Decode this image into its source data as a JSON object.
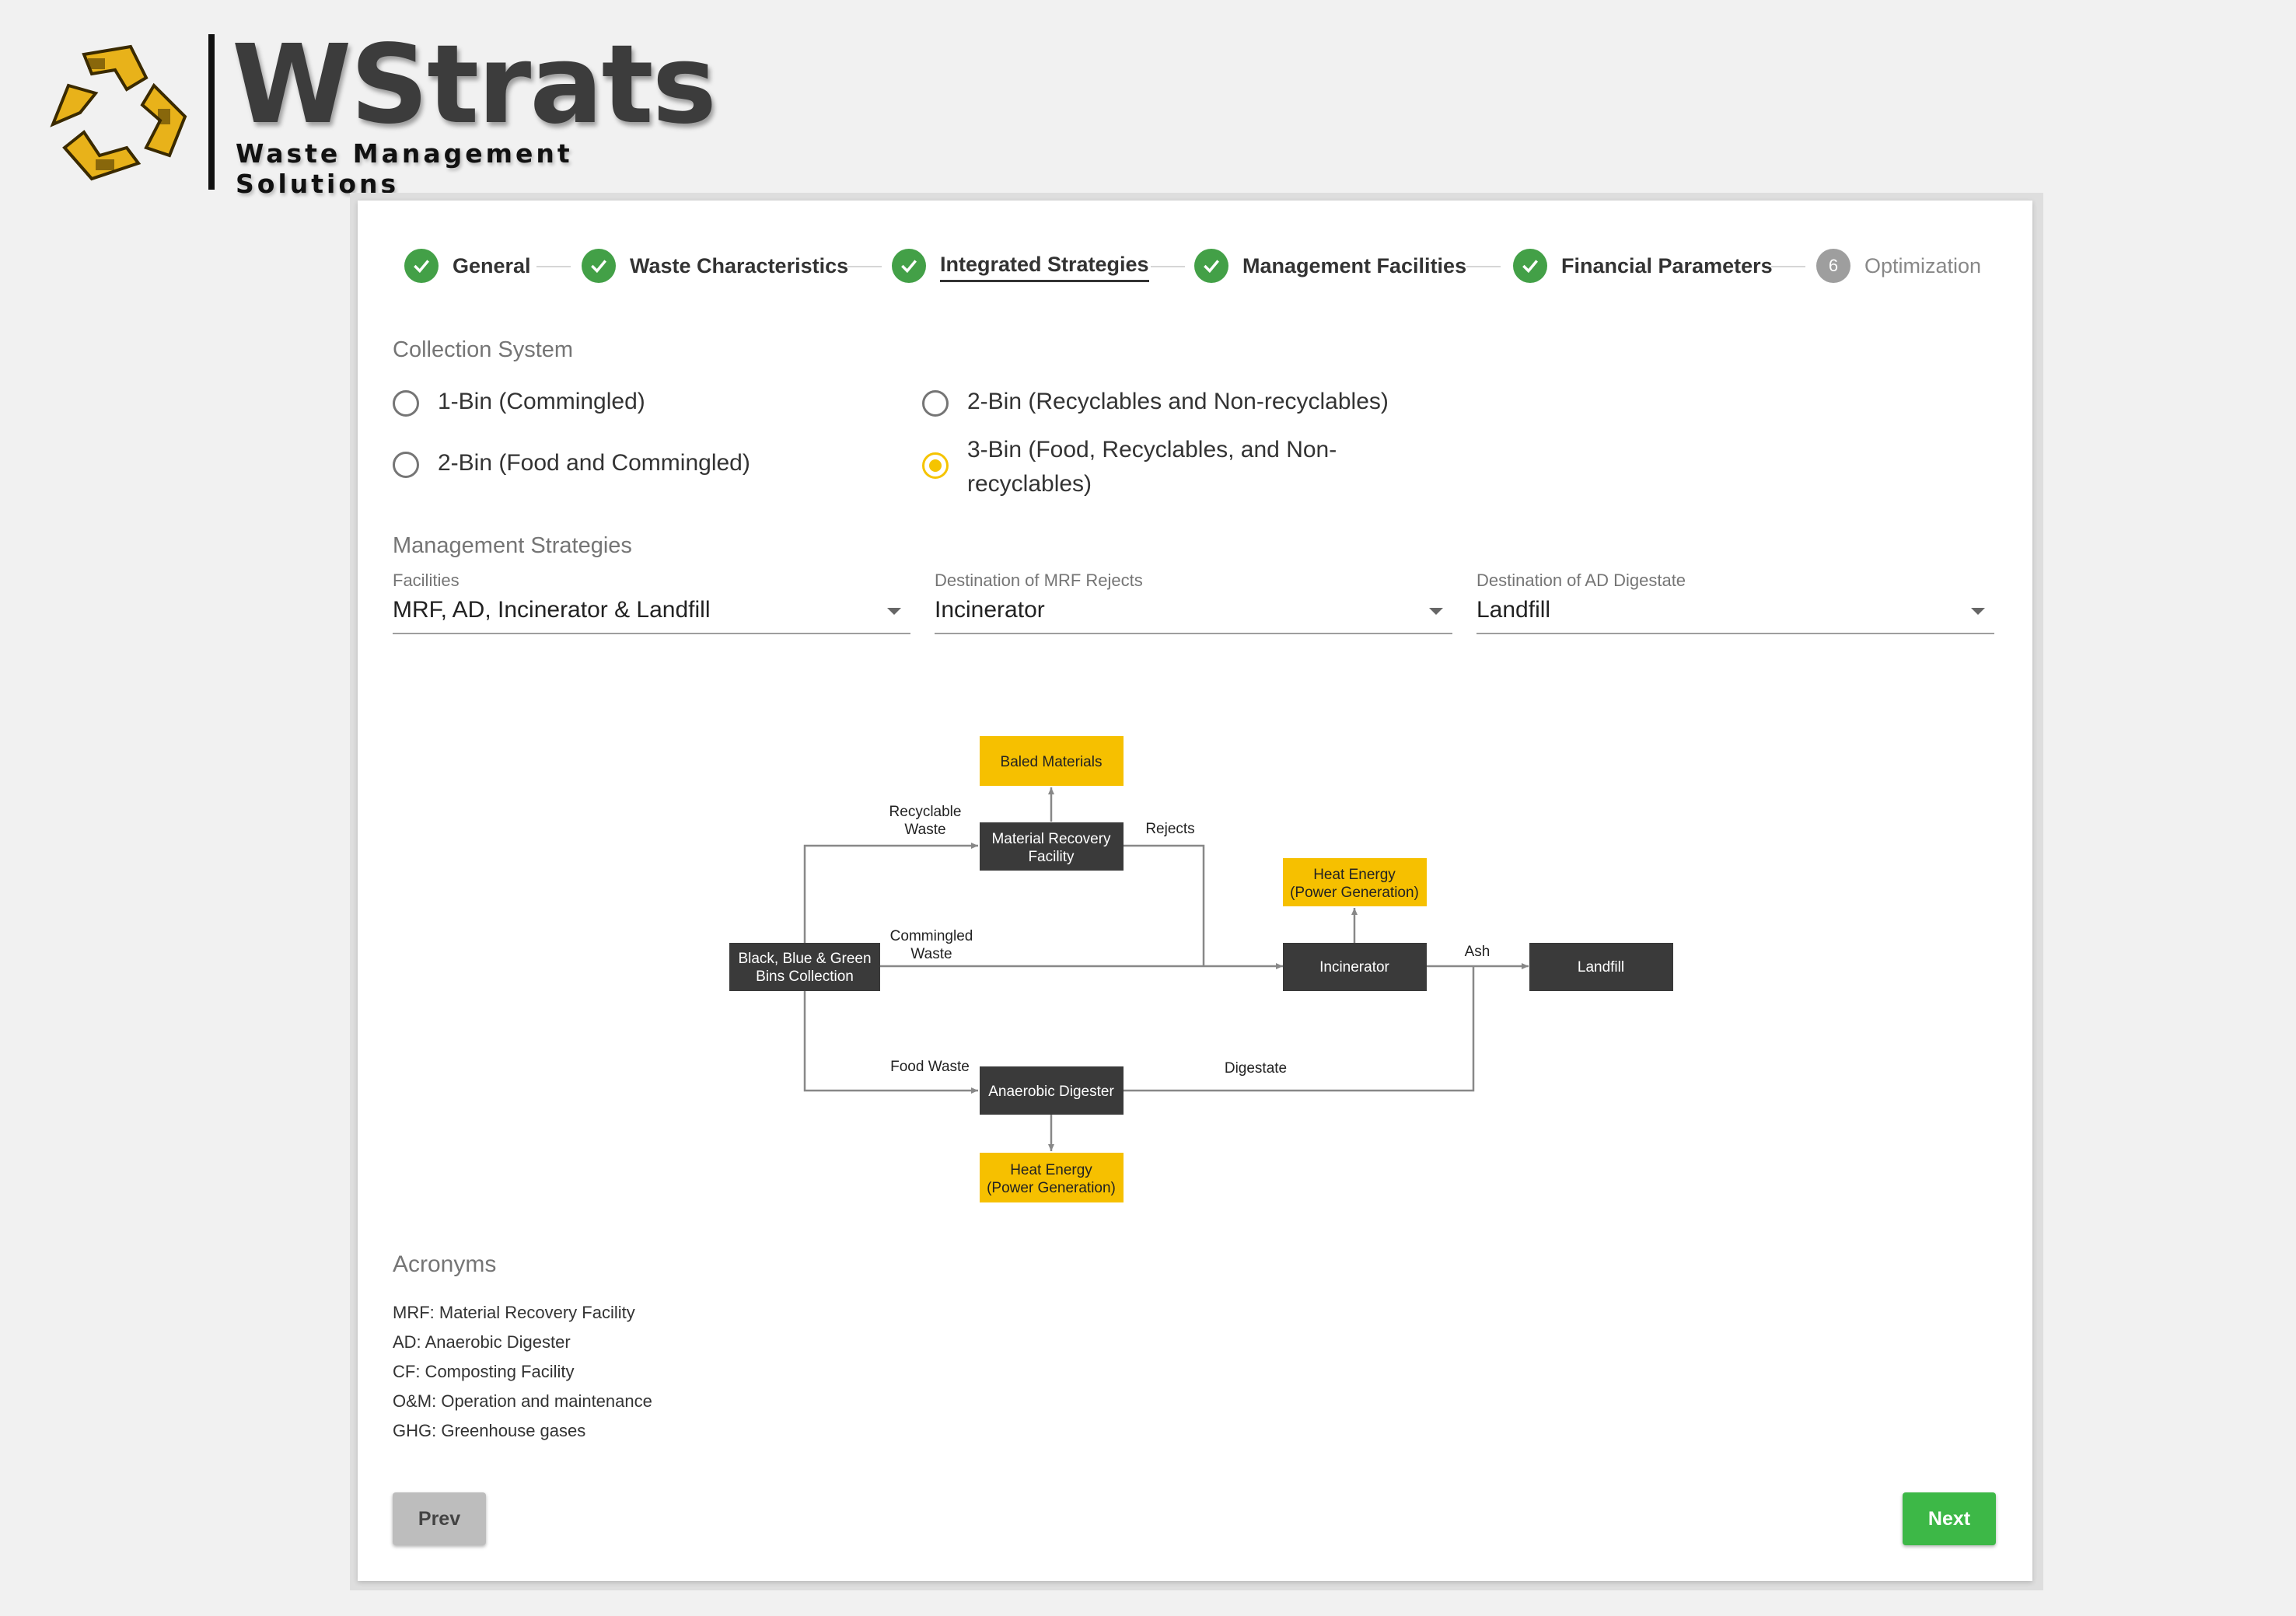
{
  "brand": {
    "title": "WStrats",
    "subtitle": "Waste Management Solutions",
    "colors": {
      "gold": "#e8b21a",
      "dark": "#3c3c3c"
    }
  },
  "stepper": {
    "steps": [
      {
        "label": "General",
        "state": "complete"
      },
      {
        "label": "Waste Characteristics",
        "state": "complete"
      },
      {
        "label": "Integrated Strategies",
        "state": "active"
      },
      {
        "label": "Management Facilities",
        "state": "complete"
      },
      {
        "label": "Financial Parameters",
        "state": "complete"
      },
      {
        "label": "Optimization",
        "state": "pending",
        "number": "6"
      }
    ],
    "colors": {
      "complete": "#43a047",
      "pending": "#9e9e9e"
    }
  },
  "collection": {
    "title": "Collection System",
    "options": [
      {
        "label": "1-Bin (Commingled)",
        "selected": false
      },
      {
        "label": "2-Bin (Recyclables and Non-recyclables)",
        "selected": false
      },
      {
        "label": "2-Bin (Food and Commingled)",
        "selected": false
      },
      {
        "label": "3-Bin (Food, Recyclables, and Non-recyclables)",
        "selected": true
      }
    ],
    "accent": "#f5c400"
  },
  "management": {
    "title": "Management Strategies",
    "facilities": {
      "label": "Facilities",
      "value": "MRF, AD, Incinerator & Landfill"
    },
    "mrf_rejects": {
      "label": "Destination of MRF Rejects",
      "value": "Incinerator"
    },
    "ad_digestate": {
      "label": "Destination of AD Digestate",
      "value": "Landfill"
    }
  },
  "diagram": {
    "nodes": {
      "baled": "Baled Materials",
      "mrf_1": "Material Recovery",
      "mrf_2": "Facility",
      "heat_top_1": "Heat Energy",
      "heat_top_2": "(Power Generation)",
      "bins_1": "Black, Blue & Green",
      "bins_2": "Bins Collection",
      "incinerator": "Incinerator",
      "landfill": "Landfill",
      "ad": "Anaerobic Digester",
      "heat_bottom_1": "Heat Energy",
      "heat_bottom_2": "(Power Generation)"
    },
    "edges": {
      "recyclable_1": "Recyclable",
      "recyclable_2": "Waste",
      "rejects": "Rejects",
      "commingled_1": "Commingled",
      "commingled_2": "Waste",
      "ash": "Ash",
      "food": "Food Waste",
      "digestate": "Digestate"
    },
    "colors": {
      "dark_node": "#3a3a3a",
      "yellow_node": "#f6c000",
      "line": "#888888"
    }
  },
  "acronyms": {
    "title": "Acronyms",
    "items": [
      "MRF: Material Recovery Facility",
      "AD: Anaerobic Digester",
      "CF: Composting Facility",
      "O&M: Operation and maintenance",
      "GHG: Greenhouse gases"
    ]
  },
  "buttons": {
    "prev": "Prev",
    "next": "Next"
  }
}
